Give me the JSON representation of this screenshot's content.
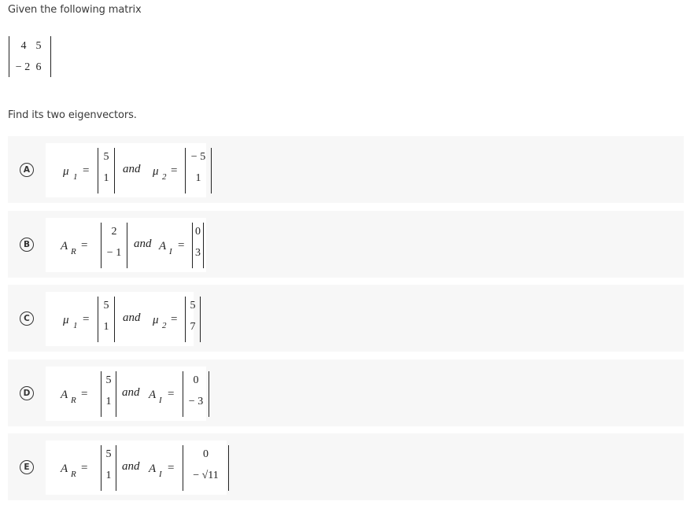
{
  "question": {
    "intro": "Given the following matrix",
    "matrix": [
      [
        "4",
        "5"
      ],
      [
        "-2",
        "6"
      ]
    ],
    "matrix_display": [
      [
        "4",
        "5"
      ],
      [
        "− 2",
        "6"
      ]
    ],
    "ask": "Find its two eigenvectors."
  },
  "options": [
    {
      "letter": "A",
      "first_symbol": "μ",
      "first_sub": "1",
      "first_vector": [
        "5",
        "1"
      ],
      "connector": "and",
      "second_symbol": "μ",
      "second_sub": "2",
      "second_vector": [
        "− 5",
        "1"
      ]
    },
    {
      "letter": "B",
      "first_symbol": "A",
      "first_sub": "R",
      "first_vector": [
        "2",
        "− 1"
      ],
      "connector": "and",
      "second_symbol": "A",
      "second_sub": "I",
      "second_vector": [
        "0",
        "3"
      ]
    },
    {
      "letter": "C",
      "first_symbol": "μ",
      "first_sub": "1",
      "first_vector": [
        "5",
        "1"
      ],
      "connector": "and",
      "second_symbol": "μ",
      "second_sub": "2",
      "second_vector": [
        "5",
        "7"
      ]
    },
    {
      "letter": "D",
      "first_symbol": "A",
      "first_sub": "R",
      "first_vector": [
        "5",
        "1"
      ],
      "connector": "and",
      "second_symbol": "A",
      "second_sub": "I",
      "second_vector": [
        "0",
        "− 3"
      ]
    },
    {
      "letter": "E",
      "first_symbol": "A",
      "first_sub": "R",
      "first_vector": [
        "5",
        "1"
      ],
      "connector": "and",
      "second_symbol": "A",
      "second_sub": "I",
      "second_vector": [
        "0",
        "− √11"
      ]
    }
  ],
  "equals": "="
}
